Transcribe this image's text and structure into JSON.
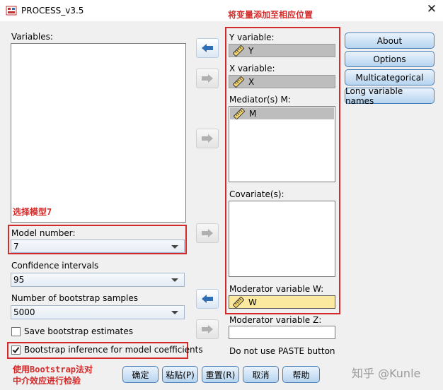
{
  "window": {
    "title": "PROCESS_v3.5",
    "close_glyph": "✕"
  },
  "annotations": {
    "add_variables": "将变量添加至相应位置",
    "select_model": "选择模型7",
    "bootstrap_line1": "使用Bootstrap法对",
    "bootstrap_line2": "中介效应进行检验"
  },
  "left": {
    "variables_label": "Variables:",
    "model_number_label": "Model number:",
    "model_number_value": "7",
    "confidence_label": "Confidence intervals",
    "confidence_value": "95",
    "bootstrap_samples_label": "Number of bootstrap samples",
    "bootstrap_samples_value": "5000",
    "save_bootstrap_label": "Save bootstrap estimates",
    "save_bootstrap_checked": false,
    "bootstrap_inference_label": "Bootstrap inference for model coefficients",
    "bootstrap_inference_checked": true
  },
  "right": {
    "y_label": "Y variable:",
    "y_value": "Y",
    "x_label": "X variable:",
    "x_value": "X",
    "mediator_label": "Mediator(s) M:",
    "mediator_values": [
      "M"
    ],
    "covariates_label": "Covariate(s):",
    "moderator_w_label": "Moderator variable W:",
    "moderator_w_value": "W",
    "moderator_z_label": "Moderator variable Z:",
    "moderator_z_value": "",
    "paste_note": "Do not use PASTE button"
  },
  "side_buttons": [
    "About",
    "Options",
    "Multicategorical",
    "Long variable names"
  ],
  "bottom_buttons": [
    "确定",
    "粘贴(P)",
    "重置(R)",
    "取消",
    "帮助"
  ],
  "watermark": "知乎 @Kunle",
  "colors": {
    "annotation_red": "#d42a2a",
    "moderator_highlight": "#fbe9a0",
    "arrow_blue": "#2f6db5"
  },
  "icons": [
    "spss-process-icon",
    "ruler-icon",
    "arrow-left-icon",
    "arrow-right-icon",
    "checkmark-icon"
  ]
}
